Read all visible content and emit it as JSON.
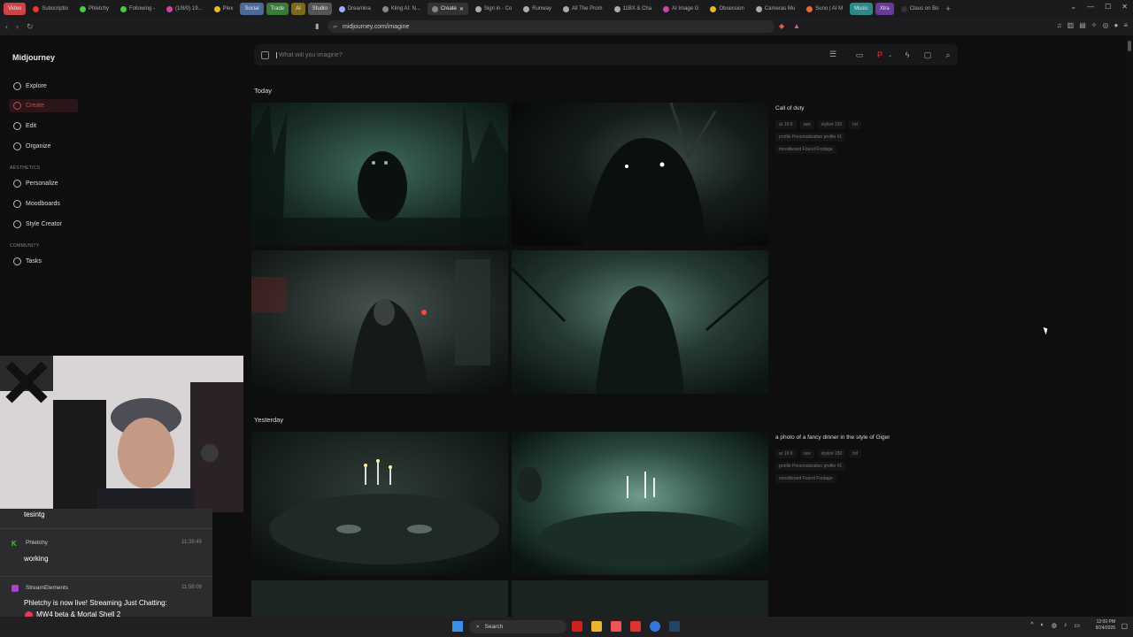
{
  "browser": {
    "tabs": [
      {
        "label": "Video",
        "color": "#c44",
        "group": true
      },
      {
        "label": "Subscriptio",
        "color": "#e33"
      },
      {
        "label": "Phletchy",
        "color": "#4c4"
      },
      {
        "label": "Following -",
        "color": "#4c4"
      },
      {
        "label": "(1/8/0) 19...",
        "color": "#c4a"
      },
      {
        "label": "Plex",
        "color": "#e9b630"
      },
      {
        "label": "Social",
        "color": "#4a6a9a",
        "group": true
      },
      {
        "label": "Trade",
        "color": "#3a7a3a",
        "group": true
      },
      {
        "label": "AI",
        "color": "#7a6a1a",
        "group": true
      },
      {
        "label": "Studio",
        "color": "#555",
        "group": true
      },
      {
        "label": "Dreamina",
        "color": "#9af"
      },
      {
        "label": "Kling AI: N...",
        "color": "#888"
      },
      {
        "label": "Create",
        "color": "#888",
        "active": true
      },
      {
        "label": "Sign in - Co",
        "color": "#aaa"
      },
      {
        "label": "Runway",
        "color": "#aaa"
      },
      {
        "label": "All The Prom",
        "color": "#aaa"
      },
      {
        "label": "11BX & Cha",
        "color": "#aaa"
      },
      {
        "label": "AI Image G",
        "color": "#c4a"
      },
      {
        "label": "Obsession",
        "color": "#e9b630"
      },
      {
        "label": "Cameras Mu",
        "color": "#aaa"
      },
      {
        "label": "Suno | AI M",
        "color": "#e63"
      },
      {
        "label": "Music",
        "color": "#2a8a8a",
        "group": true
      },
      {
        "label": "Xtra",
        "color": "#6a3a9a",
        "group": true
      },
      {
        "label": "Claus on Bo",
        "color": "#333"
      }
    ],
    "url": "midjourney.com/imagine"
  },
  "sidebar": {
    "brand": "Midjourney",
    "items": [
      {
        "label": "Explore",
        "icon": "compass-icon"
      },
      {
        "label": "Create",
        "icon": "brush-icon",
        "active": true
      },
      {
        "label": "Edit",
        "icon": "edit-icon"
      },
      {
        "label": "Organize",
        "icon": "folder-icon"
      }
    ],
    "aesthetics_label": "AESTHETICS",
    "aesthetics": [
      {
        "label": "Personalize",
        "icon": "personalize-icon"
      },
      {
        "label": "Moodboards",
        "icon": "moodboard-icon"
      },
      {
        "label": "Style Creator",
        "icon": "palette-icon"
      }
    ],
    "community_label": "COMMUNITY",
    "community": [
      {
        "label": "Tasks",
        "icon": "thumbs-up-icon"
      }
    ]
  },
  "prompt": {
    "placeholder": "What will you imagine?"
  },
  "feed": {
    "today_label": "Today",
    "yesterday_label": "Yesterday",
    "job1": {
      "prompt": "Call of duty",
      "chips": [
        "ar 16:9",
        "raw",
        "stylize 150",
        "hd",
        "profile Personalization profile #1",
        "moodboard Found Footage"
      ]
    },
    "job2": {
      "prompt": "a photo of a fancy dinner in the style of Giger",
      "chips": [
        "ar 16:9",
        "raw",
        "stylize 150",
        "hd",
        "profile Personalization profile #1",
        "moodboard Found Footage"
      ]
    }
  },
  "chat": {
    "partial_body": "tesintg",
    "messages": [
      {
        "name": "Phletchy",
        "time": "11:29:45",
        "body": "working",
        "color": "#3c3"
      },
      {
        "name": "StreamElements",
        "time": "11:58:09",
        "body": "Phletchy is now live! Streaming Just Chatting:",
        "body2": "MW4 beta & Mortal Shell 2",
        "color": "#a4c"
      }
    ]
  },
  "taskbar": {
    "search_label": "Search",
    "time": "12:00 PM",
    "date": "8/24/2026"
  }
}
